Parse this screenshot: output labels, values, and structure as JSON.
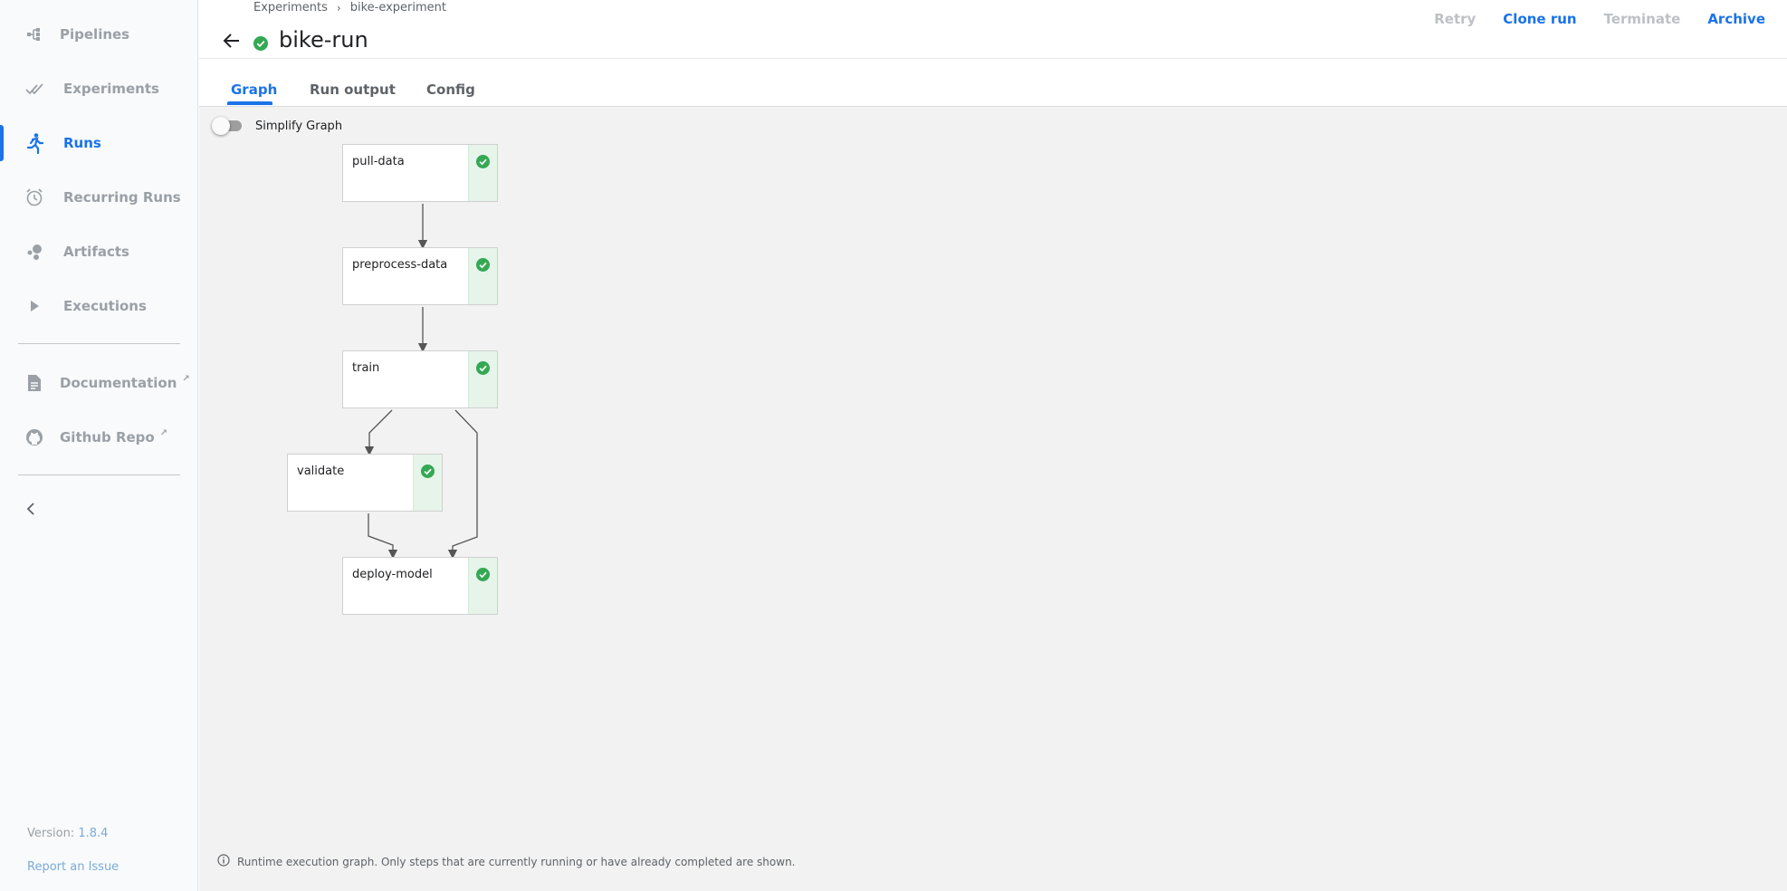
{
  "sidebar": {
    "items": [
      {
        "label": "Pipelines",
        "icon": "pipelines-icon"
      },
      {
        "label": "Experiments",
        "icon": "experiments-icon"
      },
      {
        "label": "Runs",
        "icon": "runs-icon",
        "active": true
      },
      {
        "label": "Recurring Runs",
        "icon": "alarm-clock-icon"
      },
      {
        "label": "Artifacts",
        "icon": "artifacts-icon"
      },
      {
        "label": "Executions",
        "icon": "play-icon"
      }
    ],
    "links": [
      {
        "label": "Documentation",
        "icon": "document-icon"
      },
      {
        "label": "Github Repo",
        "icon": "github-icon"
      }
    ],
    "version_label": "Version: ",
    "version": "1.8.4",
    "report": "Report an Issue"
  },
  "header": {
    "breadcrumbs": [
      "Experiments",
      "bike-experiment"
    ],
    "title": "bike-run",
    "actions": {
      "retry": "Retry",
      "clone": "Clone run",
      "terminate": "Terminate",
      "archive": "Archive"
    }
  },
  "tabs": [
    "Graph",
    "Run output",
    "Config"
  ],
  "graph": {
    "simplify_label": "Simplify Graph",
    "simplify_enabled": false,
    "nodes": [
      {
        "name": "pull-data",
        "status": "succeeded"
      },
      {
        "name": "preprocess-data",
        "status": "succeeded"
      },
      {
        "name": "train",
        "status": "succeeded"
      },
      {
        "name": "validate",
        "status": "succeeded"
      },
      {
        "name": "deploy-model",
        "status": "succeeded"
      }
    ],
    "note": "Runtime execution graph. Only steps that are currently running or have already completed are shown."
  },
  "colors": {
    "accent": "#1a73e8",
    "success": "#34a853"
  }
}
